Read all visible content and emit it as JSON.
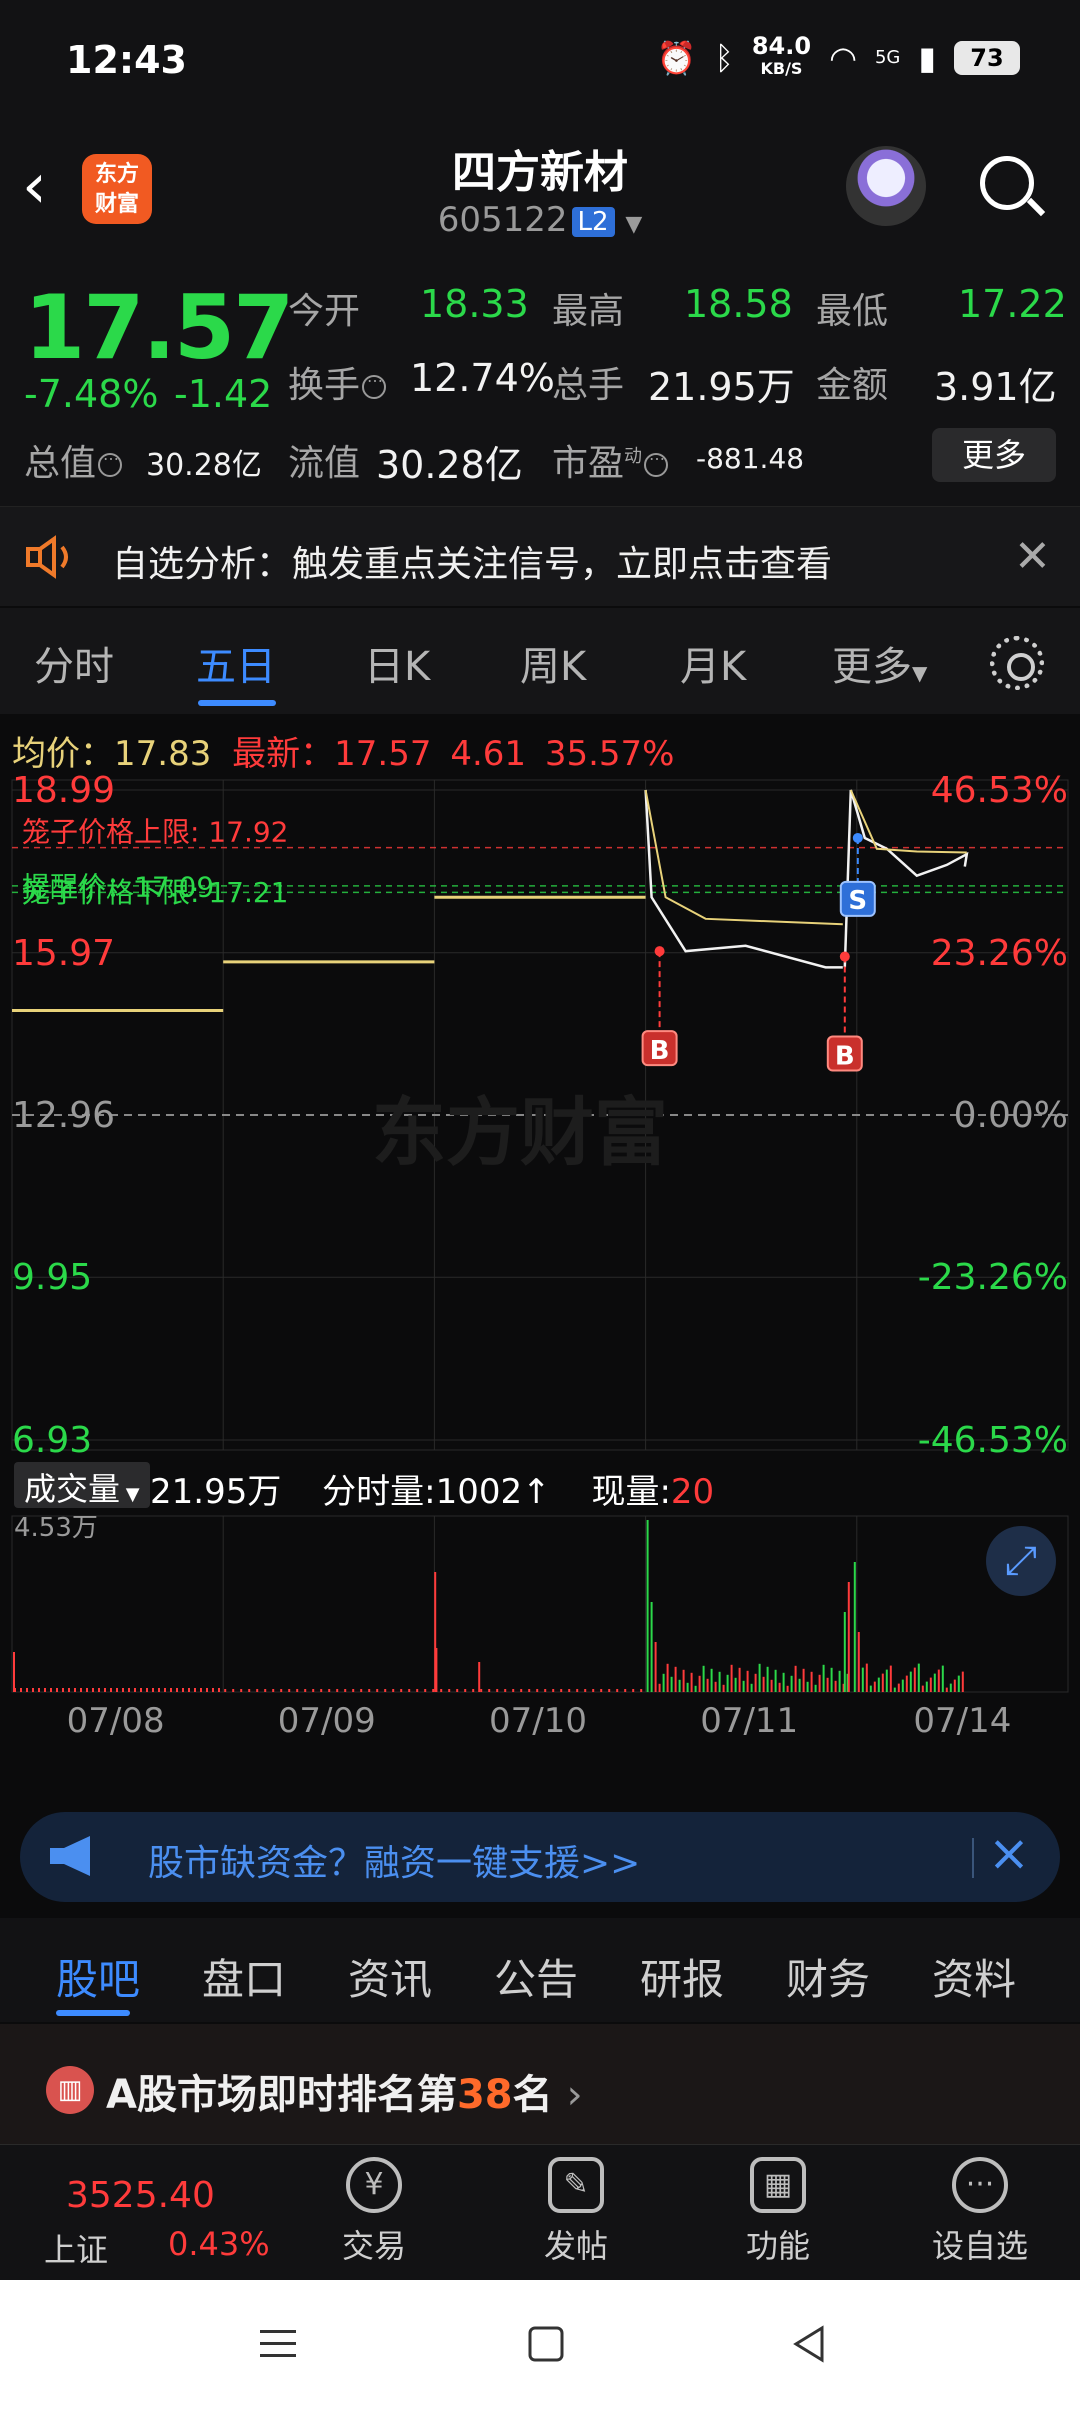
{
  "status_bar": {
    "time": "12:43",
    "net_speed": "84.0",
    "net_unit": "KB/S",
    "signal": "5G",
    "battery": "73"
  },
  "header": {
    "logo_line1": "东方",
    "logo_line2": "财富",
    "stock_name": "四方新材",
    "stock_code": "605122",
    "level_badge": "L2"
  },
  "quote": {
    "price": "17.57",
    "change_pct": "-7.48%",
    "change_abs": "-1.42",
    "open_label": "今开",
    "open": "18.33",
    "high_label": "最高",
    "high": "18.58",
    "low_label": "最低",
    "low": "17.22",
    "turnover_label": "换手",
    "turnover": "12.74%",
    "volume_label": "总手",
    "volume": "21.95万",
    "amount_label": "金额",
    "amount": "3.91亿",
    "total_cap_label": "总值",
    "total_cap": "30.28亿",
    "float_cap_label": "流值",
    "float_cap": "30.28亿",
    "pe_label": "市盈",
    "pe_sup": "动",
    "pe": "-881.48",
    "more_label": "更多"
  },
  "alert": {
    "text": "自选分析：触发重点关注信号，立即点击查看"
  },
  "period_tabs": [
    "分时",
    "五日",
    "日K",
    "周K",
    "月K",
    "更多"
  ],
  "legend": {
    "avg_label": "均价：",
    "avg_value": "17.83",
    "latest_label": "最新：",
    "latest_value": "17.57",
    "latest_chg": "4.61",
    "latest_pct": "35.57%"
  },
  "chart_data": {
    "type": "line",
    "title": "",
    "x": [
      "07/08",
      "07/09",
      "07/10",
      "07/11",
      "07/14"
    ],
    "y_left_ticks": [
      "18.99",
      "15.97",
      "12.96",
      "9.95",
      "6.93"
    ],
    "y_right_ticks": [
      "46.53%",
      "23.26%",
      "0.00%",
      "-23.26%",
      "-46.53%"
    ],
    "ylim": [
      6.93,
      18.99
    ],
    "base_price": 12.96,
    "series": [
      {
        "values": [
          14.9,
          15.8,
          17.0,
          18.99,
          17.0,
          16.0,
          16.1,
          15.7,
          18.99,
          17.9,
          17.6,
          17.8,
          17.57
        ]
      }
    ],
    "reference_lines": [
      {
        "label": "笼子价格上限",
        "value": "17.92"
      },
      {
        "label": "提醒价",
        "value": "17.09"
      },
      {
        "label": "笼子价格下限",
        "value": "17.21"
      }
    ],
    "markers": [
      {
        "type": "B",
        "day": "07/11",
        "value": 16.0
      },
      {
        "type": "B",
        "day": "07/14",
        "value": 15.9
      },
      {
        "type": "S",
        "day": "07/14",
        "value": 17.1
      }
    ],
    "volume": {
      "max_label": "4.53万"
    },
    "watermark": "东方财富"
  },
  "volume_bar": {
    "selector": "成交量",
    "total": "21.95万",
    "tick_label": "分时量:",
    "tick_value": "1002↑",
    "current_label": "现量:",
    "current_value": "20"
  },
  "ad": {
    "text": "股市缺资金？融资一键支援>>"
  },
  "content_tabs": [
    "股吧",
    "盘口",
    "资讯",
    "公告",
    "研报",
    "财务",
    "资料"
  ],
  "rank": {
    "prefix": "A股市场即时排名第",
    "number": "38",
    "suffix": "名"
  },
  "bottom_nav": {
    "index_value": "3525.40",
    "index_name": "上证",
    "index_change": "0.43%",
    "items": [
      {
        "label": "交易"
      },
      {
        "label": "发帖"
      },
      {
        "label": "功能"
      },
      {
        "label": "设自选"
      }
    ]
  },
  "colors": {
    "up": "#ff3b3b",
    "down": "#2bd94a",
    "accent": "#3d8bff",
    "avg_line": "#e8d27a"
  }
}
